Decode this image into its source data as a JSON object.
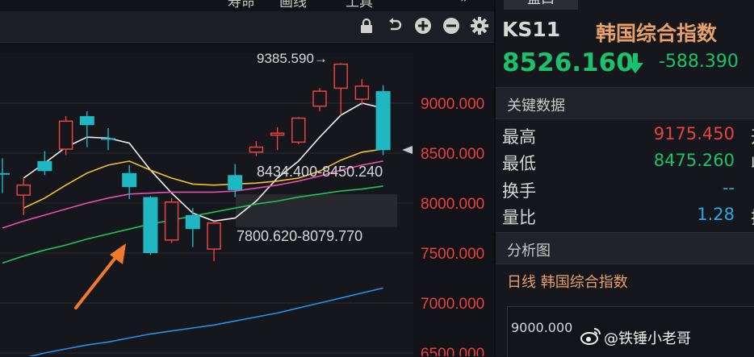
{
  "top_menu": [
    "寿命",
    "画线",
    "工具",
    "»"
  ],
  "toolbar_icons": [
    "lock-icon",
    "undo-icon",
    "zoom-in-icon",
    "zoom-out-icon",
    "settings-gear-icon"
  ],
  "right_panel": {
    "tab_label": "盘口",
    "symbol_code": "KS11",
    "symbol_name": "韩国综合指数",
    "price": "8526.160",
    "change": "-588.390",
    "key_data_title": "关键数据",
    "key_data": [
      {
        "label": "最高",
        "value": "9175.450",
        "color": "#e8433f",
        "extra": "开"
      },
      {
        "label": "最低",
        "value": "8475.260",
        "color": "#19c26b",
        "extra": "收"
      },
      {
        "label": "换手",
        "value": "--",
        "color": "#2aa8e0"
      },
      {
        "label": "量比",
        "value": "1.28",
        "color": "#2aa8e0",
        "extra": "振"
      }
    ],
    "analysis_title": "分析图",
    "subchart_title": "日线  韩国综合指数",
    "mini_tick": "9000.000"
  },
  "watermark": "@铁锤小老哥",
  "colors": {
    "up": "#e8433f",
    "down": "#1fb8c2",
    "ma5": "#f0f0f0",
    "ma10": "#f2c230",
    "ma20": "#e84fb0",
    "ma60": "#22c25a",
    "ma120": "#2a8fe8",
    "arrow": "#f07a2a"
  },
  "chart_data": {
    "type": "candlestick",
    "y_ticks": [
      "9000.000",
      "8500.000",
      "8000.000",
      "7500.000",
      "7000.000",
      "6500.000"
    ],
    "tick_values": [
      9000,
      8500,
      8000,
      7500,
      7000,
      6500
    ],
    "candles": [
      {
        "o": 8300,
        "c": 8290,
        "h": 8450,
        "l": 8100
      },
      {
        "o": 8080,
        "c": 8180,
        "h": 8250,
        "l": 7880
      },
      {
        "o": 8420,
        "c": 8320,
        "h": 8520,
        "l": 8280
      },
      {
        "o": 8540,
        "c": 8820,
        "h": 8870,
        "l": 8480
      },
      {
        "o": 8870,
        "c": 8780,
        "h": 8920,
        "l": 8560
      },
      {
        "o": 8650,
        "c": 8640,
        "h": 8750,
        "l": 8530
      },
      {
        "o": 8300,
        "c": 8160,
        "h": 8380,
        "l": 8040
      },
      {
        "o": 8060,
        "c": 7500,
        "h": 8070,
        "l": 7480
      },
      {
        "o": 7630,
        "c": 8010,
        "h": 8050,
        "l": 7600
      },
      {
        "o": 7880,
        "c": 7740,
        "h": 7950,
        "l": 7560
      },
      {
        "o": 7540,
        "c": 7800,
        "h": 7820,
        "l": 7420
      },
      {
        "o": 8280,
        "c": 8130,
        "h": 8390,
        "l": 8060
      },
      {
        "o": 8510,
        "c": 8560,
        "h": 8620,
        "l": 8470
      },
      {
        "o": 8680,
        "c": 8700,
        "h": 8760,
        "l": 8530
      },
      {
        "o": 8610,
        "c": 8850,
        "h": 8860,
        "l": 8590
      },
      {
        "o": 8970,
        "c": 9120,
        "h": 9150,
        "l": 8920
      },
      {
        "o": 9150,
        "c": 9390,
        "h": 9400,
        "l": 8880
      },
      {
        "o": 9040,
        "c": 9170,
        "h": 9240,
        "l": 8980
      },
      {
        "o": 9120,
        "c": 8530,
        "h": 9180,
        "l": 8480
      }
    ],
    "ma_lines": [
      {
        "name": "MA5",
        "values": [
          null,
          8250,
          8400,
          8560,
          8660,
          8650,
          8600,
          8330,
          8100,
          7900,
          7820,
          7850,
          8020,
          8250,
          8420,
          8660,
          8880,
          9000,
          8950
        ]
      },
      {
        "name": "MA10",
        "values": [
          null,
          7950,
          8050,
          8180,
          8300,
          8380,
          8420,
          8330,
          8250,
          8190,
          8180,
          8190,
          8200,
          8220,
          8250,
          8320,
          8430,
          8510,
          8540
        ]
      },
      {
        "name": "MA20",
        "values": [
          7750,
          7820,
          7880,
          7940,
          8000,
          8050,
          8090,
          8100,
          8110,
          8110,
          8110,
          8120,
          8150,
          8180,
          8220,
          8270,
          8330,
          8380,
          8420
        ]
      },
      {
        "name": "MA60",
        "values": [
          7400,
          7470,
          7530,
          7580,
          7640,
          7690,
          7740,
          7790,
          7830,
          7870,
          7910,
          7950,
          7990,
          8020,
          8060,
          8090,
          8120,
          8140,
          8170
        ]
      },
      {
        "name": "MA120",
        "values": [
          6400,
          6450,
          6500,
          6540,
          6580,
          6610,
          6650,
          6690,
          6720,
          6750,
          6780,
          6820,
          6860,
          6900,
          6950,
          7000,
          7050,
          7100,
          7150
        ]
      }
    ],
    "annotations": [
      "9385.590→",
      "8434.400-8450.240",
      "7800.620-8079.770"
    ],
    "annotation_values": [
      9385.59,
      8434.4,
      8079.77
    ]
  }
}
